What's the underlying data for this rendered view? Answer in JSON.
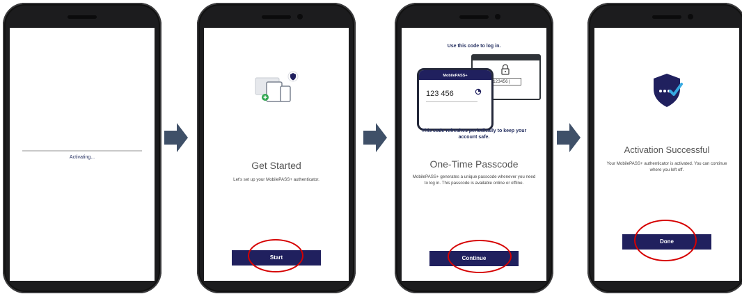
{
  "screens": {
    "activating": {
      "status_text": "Activating..."
    },
    "get_started": {
      "title": "Get Started",
      "description": "Let's set up your MobilePASS+ authenticator.",
      "button_label": "Start"
    },
    "passcode": {
      "heading": "Use this code to log in.",
      "phone_app_label": "MobilePASS+",
      "phone_code": "123 456",
      "browser_code": "123456|",
      "refresh_note": "This code refreshes periodically to keep your account safe.",
      "title": "One-Time Passcode",
      "description": "MobilePASS+ generates a unique passcode whenever you need to log in. This passcode is available online or offline.",
      "button_label": "Continue"
    },
    "success": {
      "title": "Activation Successful",
      "description": "Your MobilePASS+ authenticator is activated. You can continue where you left off.",
      "button_label": "Done"
    }
  },
  "colors": {
    "brand_navy": "#20205e",
    "highlight_red": "#d60000",
    "arrow_slate": "#3f5068"
  }
}
